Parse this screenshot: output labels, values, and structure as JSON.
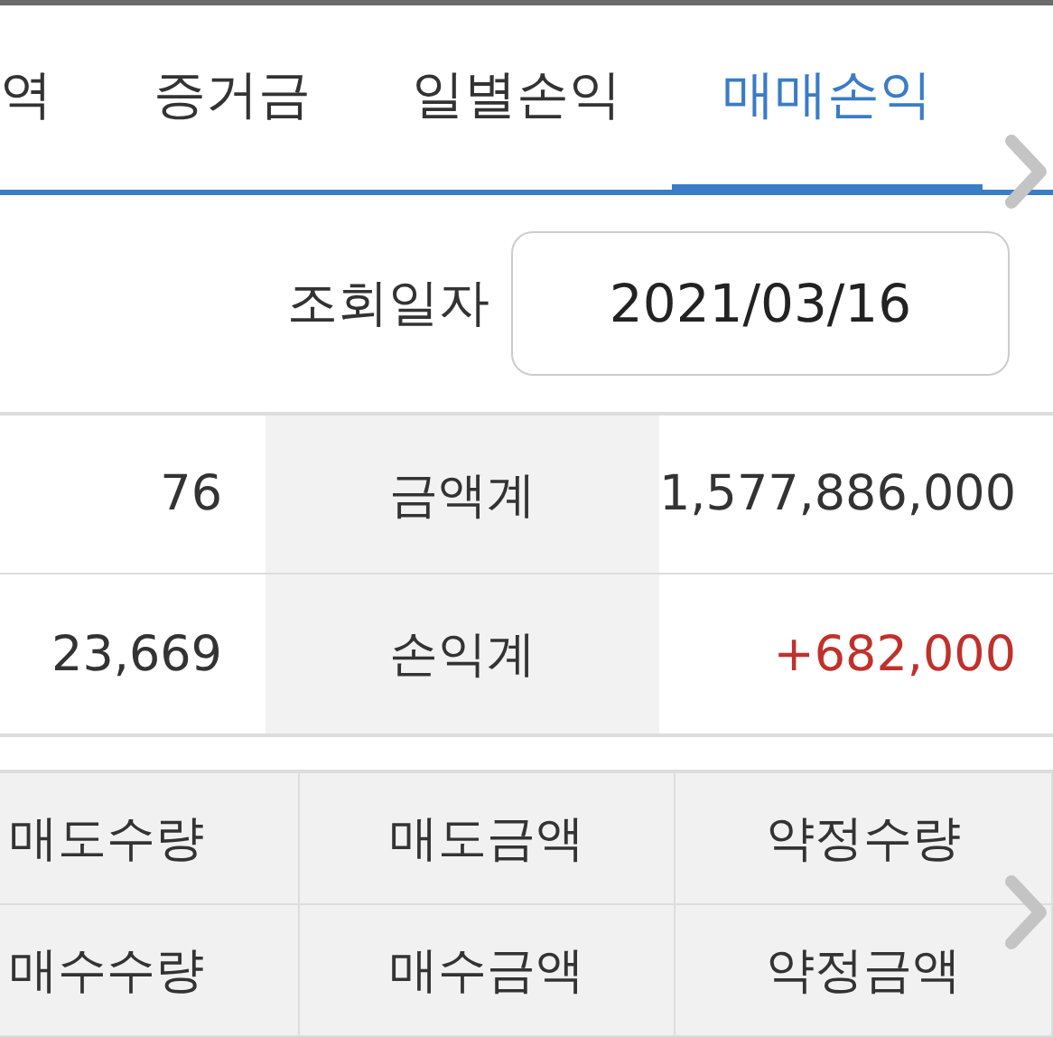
{
  "tabs": [
    {
      "label": "역",
      "selected": false
    },
    {
      "label": "증거금",
      "selected": false
    },
    {
      "label": "일별손익",
      "selected": false
    },
    {
      "label": "매매손익",
      "selected": true
    }
  ],
  "query": {
    "label": "조회일자",
    "value": "2021/03/16"
  },
  "summary": {
    "rows": [
      {
        "value": "76",
        "label": "금액계",
        "total": "1,577,886,000",
        "color": "#333333"
      },
      {
        "value": "23,669",
        "label": "손익계",
        "total": "+682,000",
        "color": "#c0312b"
      }
    ]
  },
  "header_grid": {
    "rows": [
      [
        "매도수량",
        "매도금액",
        "약정수량"
      ],
      [
        "매수수량",
        "매수금액",
        "약정금액"
      ]
    ]
  }
}
